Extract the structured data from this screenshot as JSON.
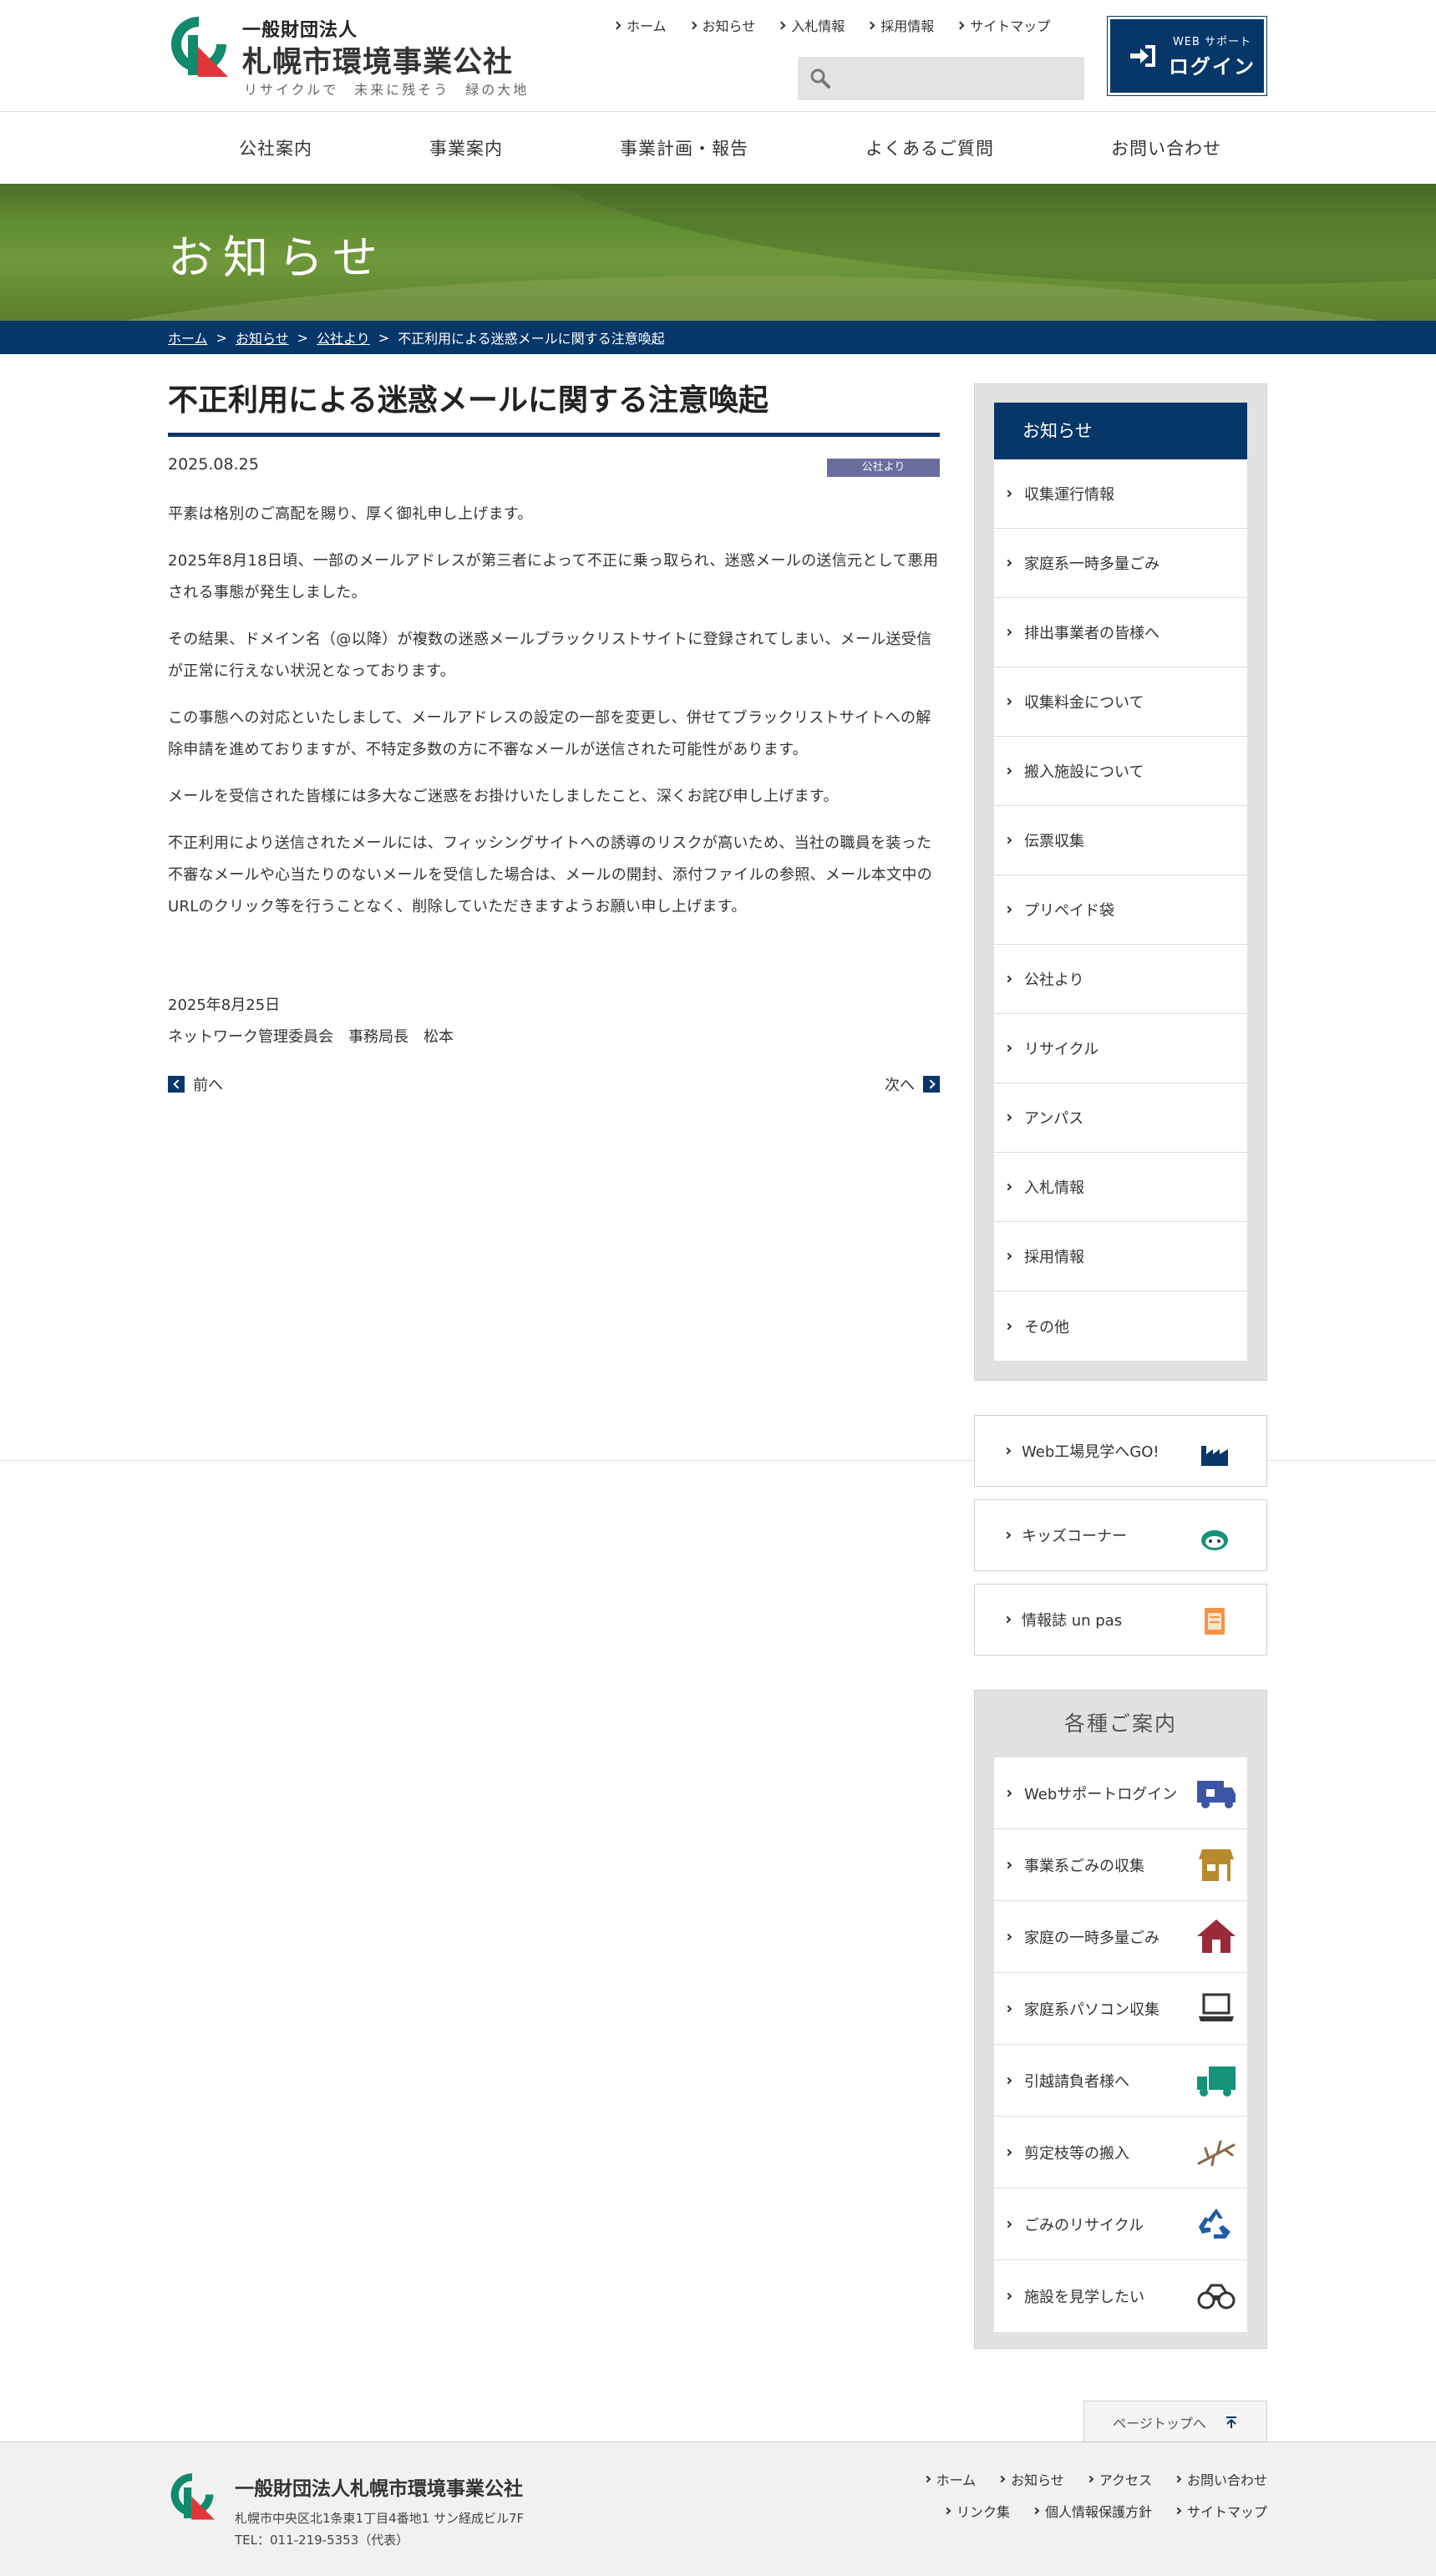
{
  "header": {
    "org_type": "一般財団法人",
    "org_name": "札幌市環境事業公社",
    "tagline": "リサイクルで　未来に残そう　緑の大地",
    "top_links": [
      "ホーム",
      "お知らせ",
      "入札情報",
      "採用情報",
      "サイトマップ"
    ],
    "search_placeholder": "",
    "login_small": "WEB サポート",
    "login_big": "ログイン"
  },
  "gnav": [
    "公社案内",
    "事業案内",
    "事業計画・報告",
    "よくあるご質問",
    "お問い合わせ"
  ],
  "hero": {
    "title": "お知らせ"
  },
  "breadcrumb": {
    "home": "ホーム",
    "news": "お知らせ",
    "category": "公社より",
    "current": "不正利用による迷惑メールに関する注意喚起",
    "sep": ">"
  },
  "article": {
    "title": "不正利用による迷惑メールに関する注意喚起",
    "date": "2025.08.25",
    "category": "公社より",
    "paragraphs": [
      "平素は格別のご高配を賜り、厚く御礼申し上げます。",
      "2025年8月18日頃、一部のメールアドレスが第三者によって不正に乗っ取られ、迷惑メールの送信元として悪用される事態が発生しました。",
      "その結果、ドメイン名（@以降）が複数の迷惑メールブラックリストサイトに登録されてしまい、メール送受信が正常に行えない状況となっております。",
      "この事態への対応といたしまして、メールアドレスの設定の一部を変更し、併せてブラックリストサイトへの解除申請を進めておりますが、不特定多数の方に不審なメールが送信された可能性があります。",
      "メールを受信された皆様には多大なご迷惑をお掛けいたしましたこと、深くお詫び申し上げます。",
      "不正利用により送信されたメールには、フィッシングサイトへの誘導のリスクが高いため、当社の職員を装った不審なメールや心当たりのないメールを受信した場合は、メールの開封、添付ファイルの参照、メール本文中のURLのクリック等を行うことなく、削除していただきますようお願い申し上げます。"
    ],
    "sign_date": "2025年8月25日",
    "sign_by": "ネットワーク管理委員会　事務局長　松本",
    "prev": "前へ",
    "next": "次へ"
  },
  "sidebar": {
    "news_heading": "お知らせ",
    "news_items": [
      "収集運行情報",
      "家庭系一時多量ごみ",
      "排出事業者の皆様へ",
      "収集料金について",
      "搬入施設について",
      "伝票収集",
      "プリペイド袋",
      "公社より",
      "リサイクル",
      "アンパス",
      "入札情報",
      "採用情報",
      "その他"
    ],
    "banners": [
      "Web工場見学へGO!",
      "キッズコーナー",
      "情報誌 un pas"
    ],
    "guide_heading": "各種ご案内",
    "guide_items": [
      "Webサポートログイン",
      "事業系ごみの収集",
      "家庭の一時多量ごみ",
      "家庭系パソコン収集",
      "引越請負者様へ",
      "剪定枝等の搬入",
      "ごみのリサイクル",
      "施設を見学したい"
    ]
  },
  "pagetop": "ページトップへ",
  "footer": {
    "name": "一般財団法人札幌市環境事業公社",
    "address": "札幌市中央区北1条東1丁目4番地1 サン経成ビル7F",
    "tel": "TEL：011-219-5353（代表）",
    "links_row1": [
      "ホーム",
      "お知らせ",
      "アクセス",
      "お問い合わせ"
    ],
    "links_row2": [
      "リンク集",
      "個人情報保護方針",
      "サイトマップ"
    ]
  },
  "colors": {
    "brand_navy": "#073769",
    "logo_green": "#128a6d",
    "logo_red": "#e0363a",
    "category_badge": "#6a6e9e"
  }
}
